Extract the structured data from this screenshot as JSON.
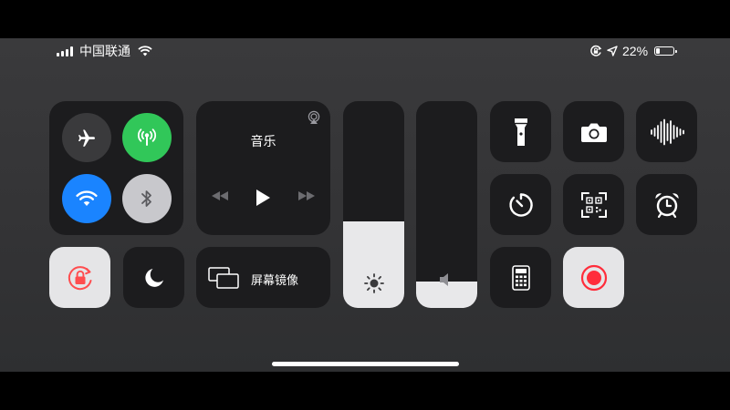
{
  "status_bar": {
    "carrier": "中国联通",
    "battery_percent": "22%",
    "battery_level": 0.22,
    "signal_bars": 4
  },
  "music": {
    "title": "音乐"
  },
  "screen_mirroring": {
    "label": "屏幕镜像"
  },
  "brightness": {
    "level": 0.42
  },
  "volume": {
    "level": 0.13
  },
  "colors": {
    "cellular_on": "#31c759",
    "wifi_on": "#1a84ff",
    "record": "#ff2d3b",
    "rotation_lock": "#ff4d4f"
  }
}
